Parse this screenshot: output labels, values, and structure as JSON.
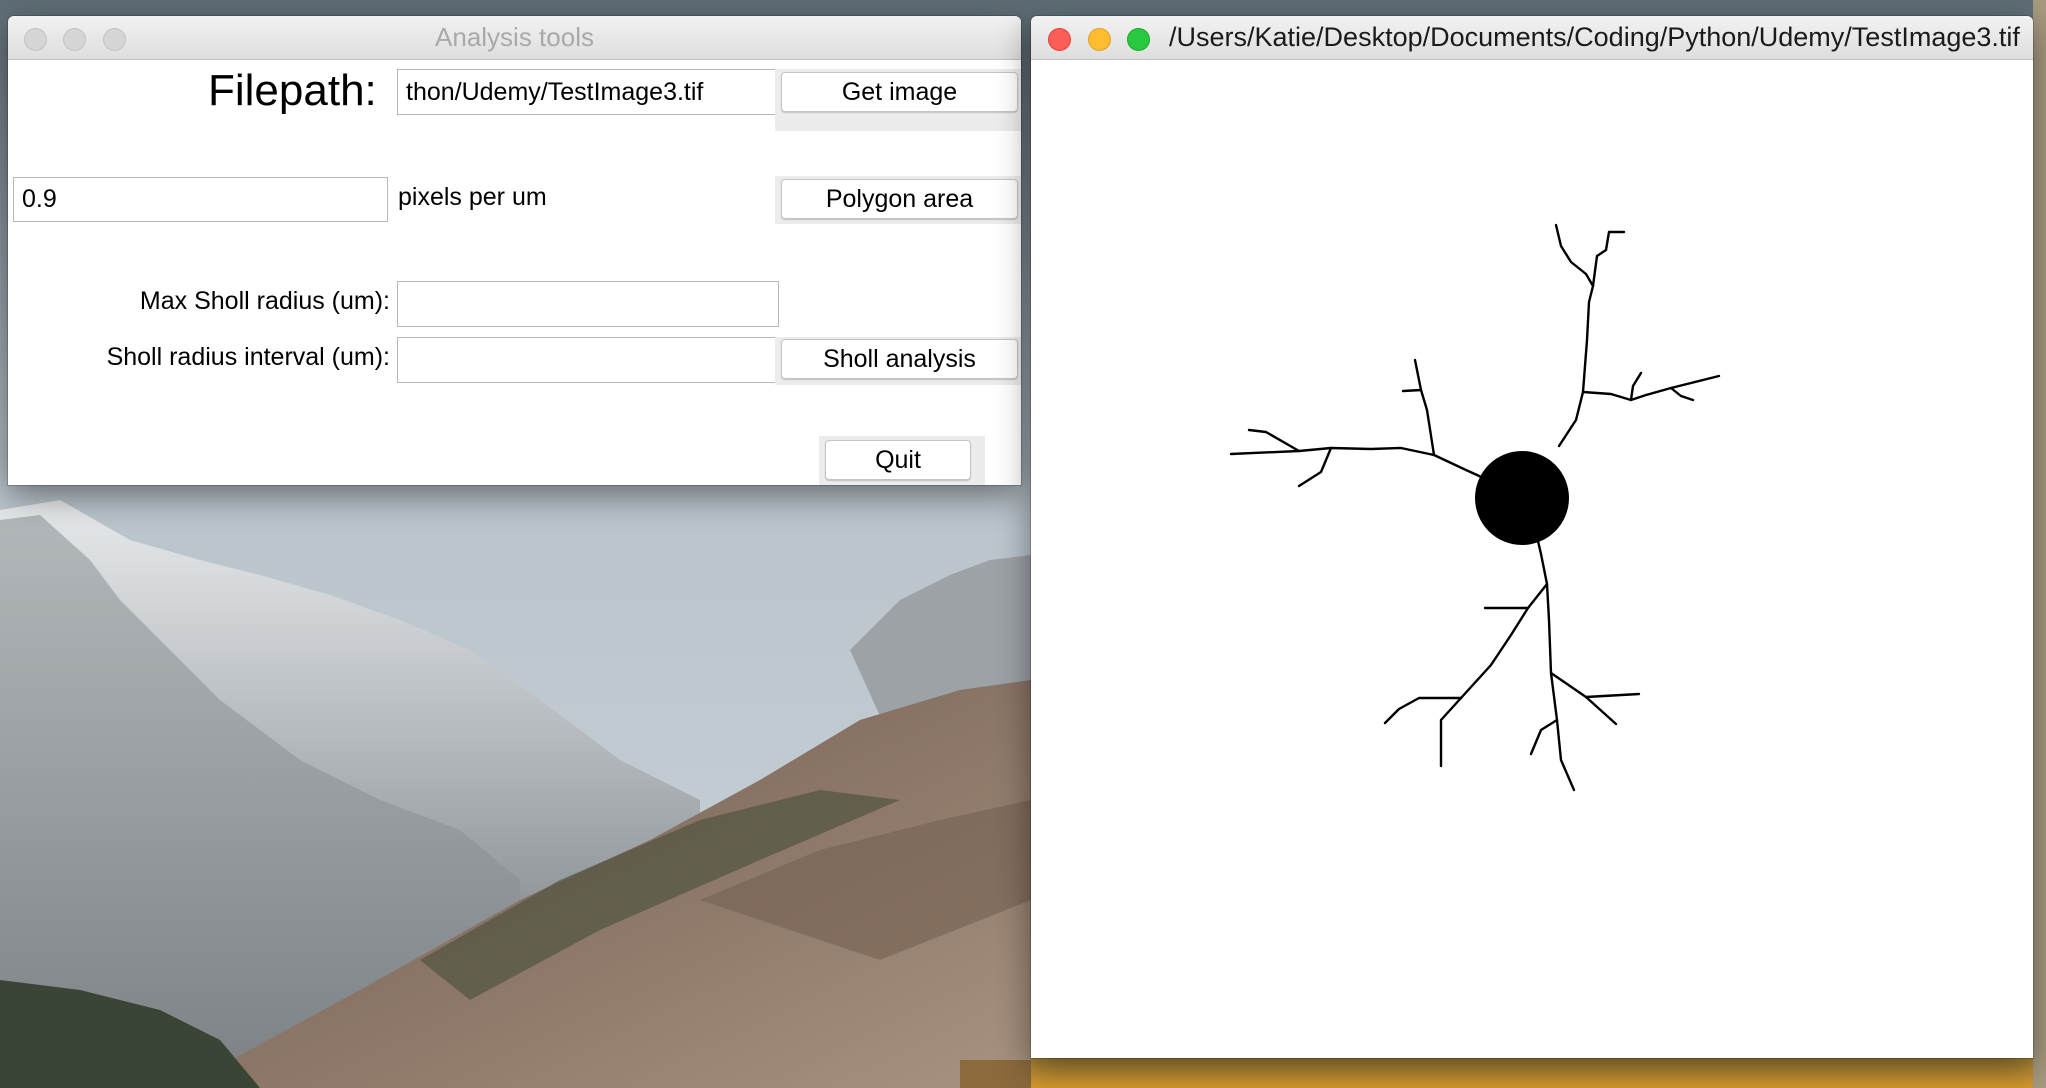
{
  "tools_window": {
    "title": "Analysis tools",
    "filepath_label": "Filepath:",
    "filepath_value": "thon/Udemy/TestImage3.tif",
    "get_image_label": "Get image",
    "pixels_value": "0.9",
    "pixels_label": "pixels per um",
    "polygon_area_label": "Polygon area",
    "max_sholl_label": "Max Sholl radius (um):",
    "max_sholl_value": "",
    "sholl_interval_label": "Sholl radius interval (um):",
    "sholl_interval_value": "",
    "sholl_analysis_label": "Sholl analysis",
    "quit_label": "Quit"
  },
  "image_window": {
    "title": "/Users/Katie/Desktop/Documents/Coding/Python/Udemy/TestImage3.tif"
  },
  "colors": {
    "close": "#fd5e57",
    "minimize": "#febc2e",
    "zoom": "#28c840",
    "inactive_button": "#d6d6d6"
  },
  "icons": [
    "close-icon",
    "minimize-icon",
    "zoom-icon"
  ]
}
